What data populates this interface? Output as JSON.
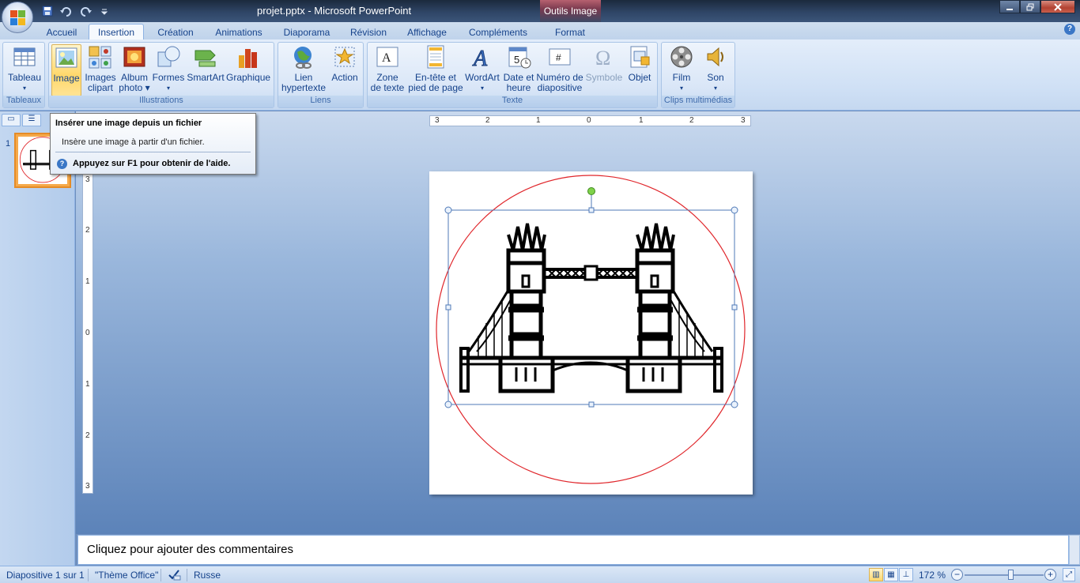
{
  "window": {
    "title": "projet.pptx - Microsoft PowerPoint",
    "contextual_tab": "Outils Image",
    "controls": [
      "minimize",
      "restore",
      "close"
    ]
  },
  "quick_access": [
    "save-icon",
    "undo-icon",
    "redo-icon",
    "customize-icon"
  ],
  "tabs": [
    {
      "label": "Accueil"
    },
    {
      "label": "Insertion",
      "active": true
    },
    {
      "label": "Création"
    },
    {
      "label": "Animations"
    },
    {
      "label": "Diaporama"
    },
    {
      "label": "Révision"
    },
    {
      "label": "Affichage"
    },
    {
      "label": "Compléments"
    },
    {
      "label": "Format"
    }
  ],
  "ribbon": {
    "groups": {
      "tableaux": {
        "label": "Tableaux",
        "buttons": [
          {
            "label1": "Tableau",
            "label2": "▾",
            "icon": "table-icon"
          }
        ]
      },
      "illustrations": {
        "label": "Illustrations",
        "buttons": [
          {
            "label1": "Image",
            "label2": "",
            "icon": "picture-icon"
          },
          {
            "label1": "Images",
            "label2": "clipart",
            "icon": "clipart-icon"
          },
          {
            "label1": "Album",
            "label2": "photo ▾",
            "icon": "photo-album-icon"
          },
          {
            "label1": "Formes",
            "label2": "▾",
            "icon": "shapes-icon"
          },
          {
            "label1": "SmartArt",
            "label2": "",
            "icon": "smartart-icon"
          },
          {
            "label1": "Graphique",
            "label2": "",
            "icon": "chart-icon"
          }
        ]
      },
      "liens": {
        "label": "Liens",
        "buttons": [
          {
            "label1": "Lien",
            "label2": "hypertexte",
            "icon": "hyperlink-icon"
          },
          {
            "label1": "Action",
            "label2": "",
            "icon": "action-icon"
          }
        ]
      },
      "texte": {
        "label": "Texte",
        "buttons": [
          {
            "label1": "Zone",
            "label2": "de texte",
            "icon": "textbox-icon"
          },
          {
            "label1": "En-tête et",
            "label2": "pied de page",
            "icon": "header-footer-icon"
          },
          {
            "label1": "WordArt",
            "label2": "▾",
            "icon": "wordart-icon"
          },
          {
            "label1": "Date et",
            "label2": "heure",
            "icon": "date-time-icon"
          },
          {
            "label1": "Numéro de",
            "label2": "diapositive",
            "icon": "slide-number-icon"
          },
          {
            "label1": "Symbole",
            "label2": "",
            "icon": "symbol-icon"
          },
          {
            "label1": "Objet",
            "label2": "",
            "icon": "object-icon"
          }
        ]
      },
      "clips": {
        "label": "Clips multimédias",
        "buttons": [
          {
            "label1": "Film",
            "label2": "▾",
            "icon": "film-icon"
          },
          {
            "label1": "Son",
            "label2": "▾",
            "icon": "sound-icon"
          }
        ]
      }
    }
  },
  "tooltip": {
    "title": "Insérer une image depuis un fichier",
    "description": "Insère une image à partir d'un fichier.",
    "help": "Appuyez sur F1 pour obtenir de l'aide."
  },
  "slides_panel": {
    "slide_number": "1"
  },
  "rulers": {
    "horizontal": [
      "3",
      "2",
      "1",
      "0",
      "1",
      "2",
      "3"
    ],
    "vertical": [
      "3",
      "2",
      "1",
      "0",
      "1",
      "2",
      "3"
    ]
  },
  "notes": {
    "placeholder": "Cliquez pour ajouter des commentaires"
  },
  "statusbar": {
    "slide_info": "Diapositive 1 sur 1",
    "theme": "\"Thème Office\"",
    "language": "Russe",
    "zoom": "172 %"
  },
  "colors": {
    "circle_outline": "#e0262b",
    "selection_handle": "#4f79b7",
    "rotation_handle": "#7fd24a",
    "drawing": "#000000"
  }
}
